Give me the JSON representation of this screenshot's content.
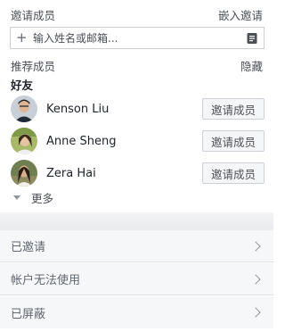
{
  "invite_header": {
    "title": "邀请成员",
    "embed_link": "嵌入邀请"
  },
  "search": {
    "placeholder": "输入姓名或邮箱...",
    "value": ""
  },
  "recommended": {
    "title": "推荐成员",
    "hide_link": "隐藏",
    "subhead": "好友"
  },
  "friends": [
    {
      "name": "Kenson Liu",
      "button": "邀请成员"
    },
    {
      "name": "Anne Sheng",
      "button": "邀请成员"
    },
    {
      "name": "Zera Hai",
      "button": "邀请成员"
    }
  ],
  "more_label": "更多",
  "sections": [
    {
      "label": "已邀请"
    },
    {
      "label": "帐户无法使用"
    },
    {
      "label": "已屏蔽"
    }
  ],
  "icons": {
    "add": "plus-icon",
    "contacts": "contact-book-icon",
    "more": "caret-down-icon",
    "row": "chevron-right-icon"
  },
  "colors": {
    "text_primary": "#1d2129",
    "text_secondary": "#4b4f56",
    "border": "#ccd0d5",
    "background_light": "#f6f7f9"
  }
}
